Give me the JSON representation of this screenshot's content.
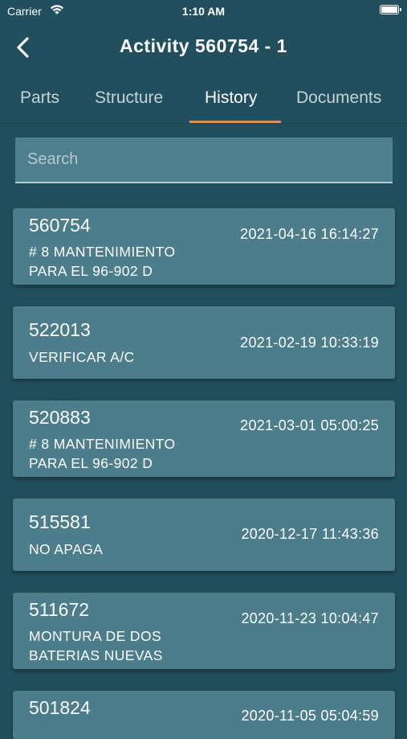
{
  "status_bar": {
    "carrier": "Carrier",
    "time": "1:10 AM"
  },
  "nav": {
    "title": "Activity  560754 - 1"
  },
  "tabs": [
    {
      "label": "Parts",
      "active": false
    },
    {
      "label": "Structure",
      "active": false
    },
    {
      "label": "History",
      "active": true
    },
    {
      "label": "Documents",
      "active": false
    }
  ],
  "search": {
    "placeholder": "Search",
    "value": ""
  },
  "history": [
    {
      "id": "560754",
      "description": "# 8 MANTENIMIENTO\nPARA EL 96-902 D",
      "datetime": "2021-04-16 16:14:27"
    },
    {
      "id": "522013",
      "description": "VERIFICAR A/C",
      "datetime": "2021-02-19 10:33:19"
    },
    {
      "id": "520883",
      "description": "# 8 MANTENIMIENTO\nPARA EL 96-902 D",
      "datetime": "2021-03-01 05:00:25"
    },
    {
      "id": "515581",
      "description": "NO APAGA",
      "datetime": "2020-12-17 11:43:36"
    },
    {
      "id": "511672",
      "description": "MONTURA DE DOS\nBATERIAS NUEVAS",
      "datetime": "2020-11-23 10:04:47"
    },
    {
      "id": "501824",
      "description": "",
      "datetime": "2020-11-05 05:04:59"
    }
  ],
  "colors": {
    "background": "#224f5d",
    "card": "#4b7e8a",
    "tab_indicator": "#e3914a"
  },
  "icons": {
    "back": "chevron-left-icon",
    "wifi": "wifi-icon",
    "battery": "battery-icon"
  }
}
